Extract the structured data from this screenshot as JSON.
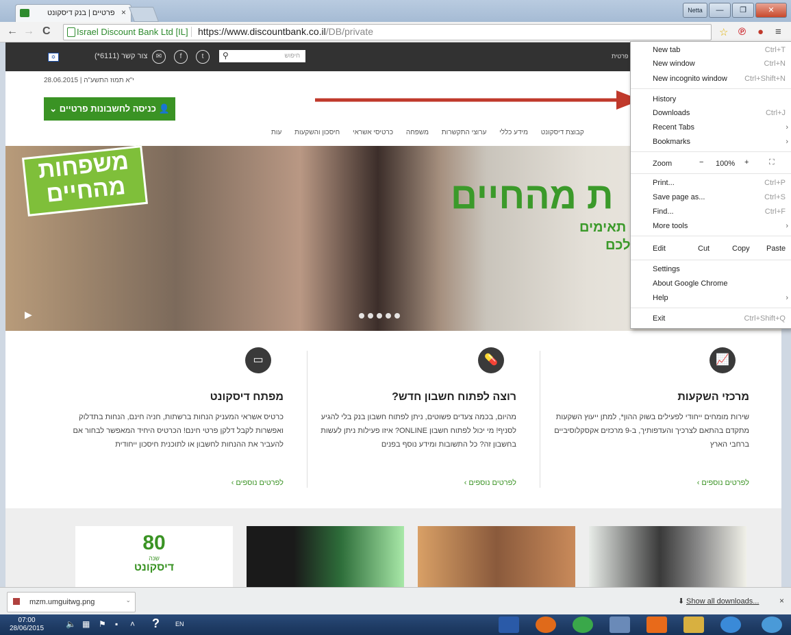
{
  "browser": {
    "tab_title": "פרטיים | בנק דיסקונט",
    "tab_close": "×",
    "window_user": "Netta",
    "ev_label": "Israel Discount Bank Ltd [IL]",
    "url_host": "https://www.discountbank.co.il",
    "url_path": "/DB/private"
  },
  "site": {
    "phone": "(*6111) צור קשר",
    "search_placeholder": "חיפוש",
    "top_link": "פרטית",
    "date": "28.06.2015 | י\"א תמוז התשע\"ה",
    "login_button": "כניסה לחשבונות פרטיים",
    "nav": [
      "קבוצת דיסקונט",
      "מידע כללי",
      "ערוצי התקשרות",
      "משפחה",
      "כרטיסי אשראי",
      "חיסכון והשקעות",
      "עות"
    ],
    "hero": {
      "badge": "משפחות מהחיים",
      "headline": "ת מהחיים",
      "sub1": "תאימים",
      "sub2": "לכם"
    },
    "features": [
      {
        "icon": "chart-icon",
        "title": "מרכזי השקעות",
        "body": "שירות מומחים ייחודי לפעילים בשוק ההון*, למתן ייעוץ השקעות מתקדם בהתאם לצרכיך והעדפותיך, ב-9 מרכזים אקסקלוסיביים ברחבי הארץ",
        "more": "לפרטים נוספים ›"
      },
      {
        "icon": "pills-icon",
        "title": "רוצה לפתוח חשבון חדש?",
        "body": "מהיום, בכמה צעדים פשוטים, ניתן לפתוח חשבון בנק בלי להגיע לסניף! מי יכול לפתוח חשבון ONLINE? איזו פעילות ניתן לעשות בחשבון זה? כל התשובות ומידע נוסף בפנים",
        "more": "לפרטים נוספים ›"
      },
      {
        "icon": "card-icon",
        "title": "מפתח דיסקונט",
        "body": "כרטיס אשראי המעניק הנחות ברשתות, חניה חינם, הנחות בתדלוק ואפשרות לקבל דלקן פרטי חינם! הכרטיס היחיד המאפשר לבחור אם להעביר את ההנחות לחשבון או לתוכנית חיסכון ייחודית",
        "more": "לפרטים נוספים ›"
      }
    ],
    "promo_logo": "דיסקונט",
    "promo_logo_num": "80",
    "promo_logo_years": "שנה"
  },
  "menu": {
    "new_tab": "New tab",
    "new_tab_sc": "Ctrl+T",
    "new_window": "New window",
    "new_window_sc": "Ctrl+N",
    "new_incognito": "New incognito window",
    "new_incognito_sc": "Ctrl+Shift+N",
    "history": "History",
    "downloads": "Downloads",
    "downloads_sc": "Ctrl+J",
    "recent_tabs": "Recent Tabs",
    "bookmarks": "Bookmarks",
    "zoom": "Zoom",
    "zoom_minus": "−",
    "zoom_value": "100%",
    "zoom_plus": "+",
    "print": "Print...",
    "print_sc": "Ctrl+P",
    "save_page": "Save page as...",
    "save_page_sc": "Ctrl+S",
    "find": "Find...",
    "find_sc": "Ctrl+F",
    "more_tools": "More tools",
    "edit": "Edit",
    "cut": "Cut",
    "copy": "Copy",
    "paste": "Paste",
    "settings": "Settings",
    "about": "About Google Chrome",
    "help": "Help",
    "exit": "Exit",
    "exit_sc": "Ctrl+Shift+Q"
  },
  "downloads_bar": {
    "file": "mzm.umguitwg.png",
    "show_all": "Show all downloads...",
    "close": "×"
  },
  "taskbar": {
    "time": "07:00",
    "date": "28/06/2015",
    "lang": "EN"
  },
  "colors": {
    "brand_green": "#3a9324",
    "arrow_red": "#c0392b"
  }
}
